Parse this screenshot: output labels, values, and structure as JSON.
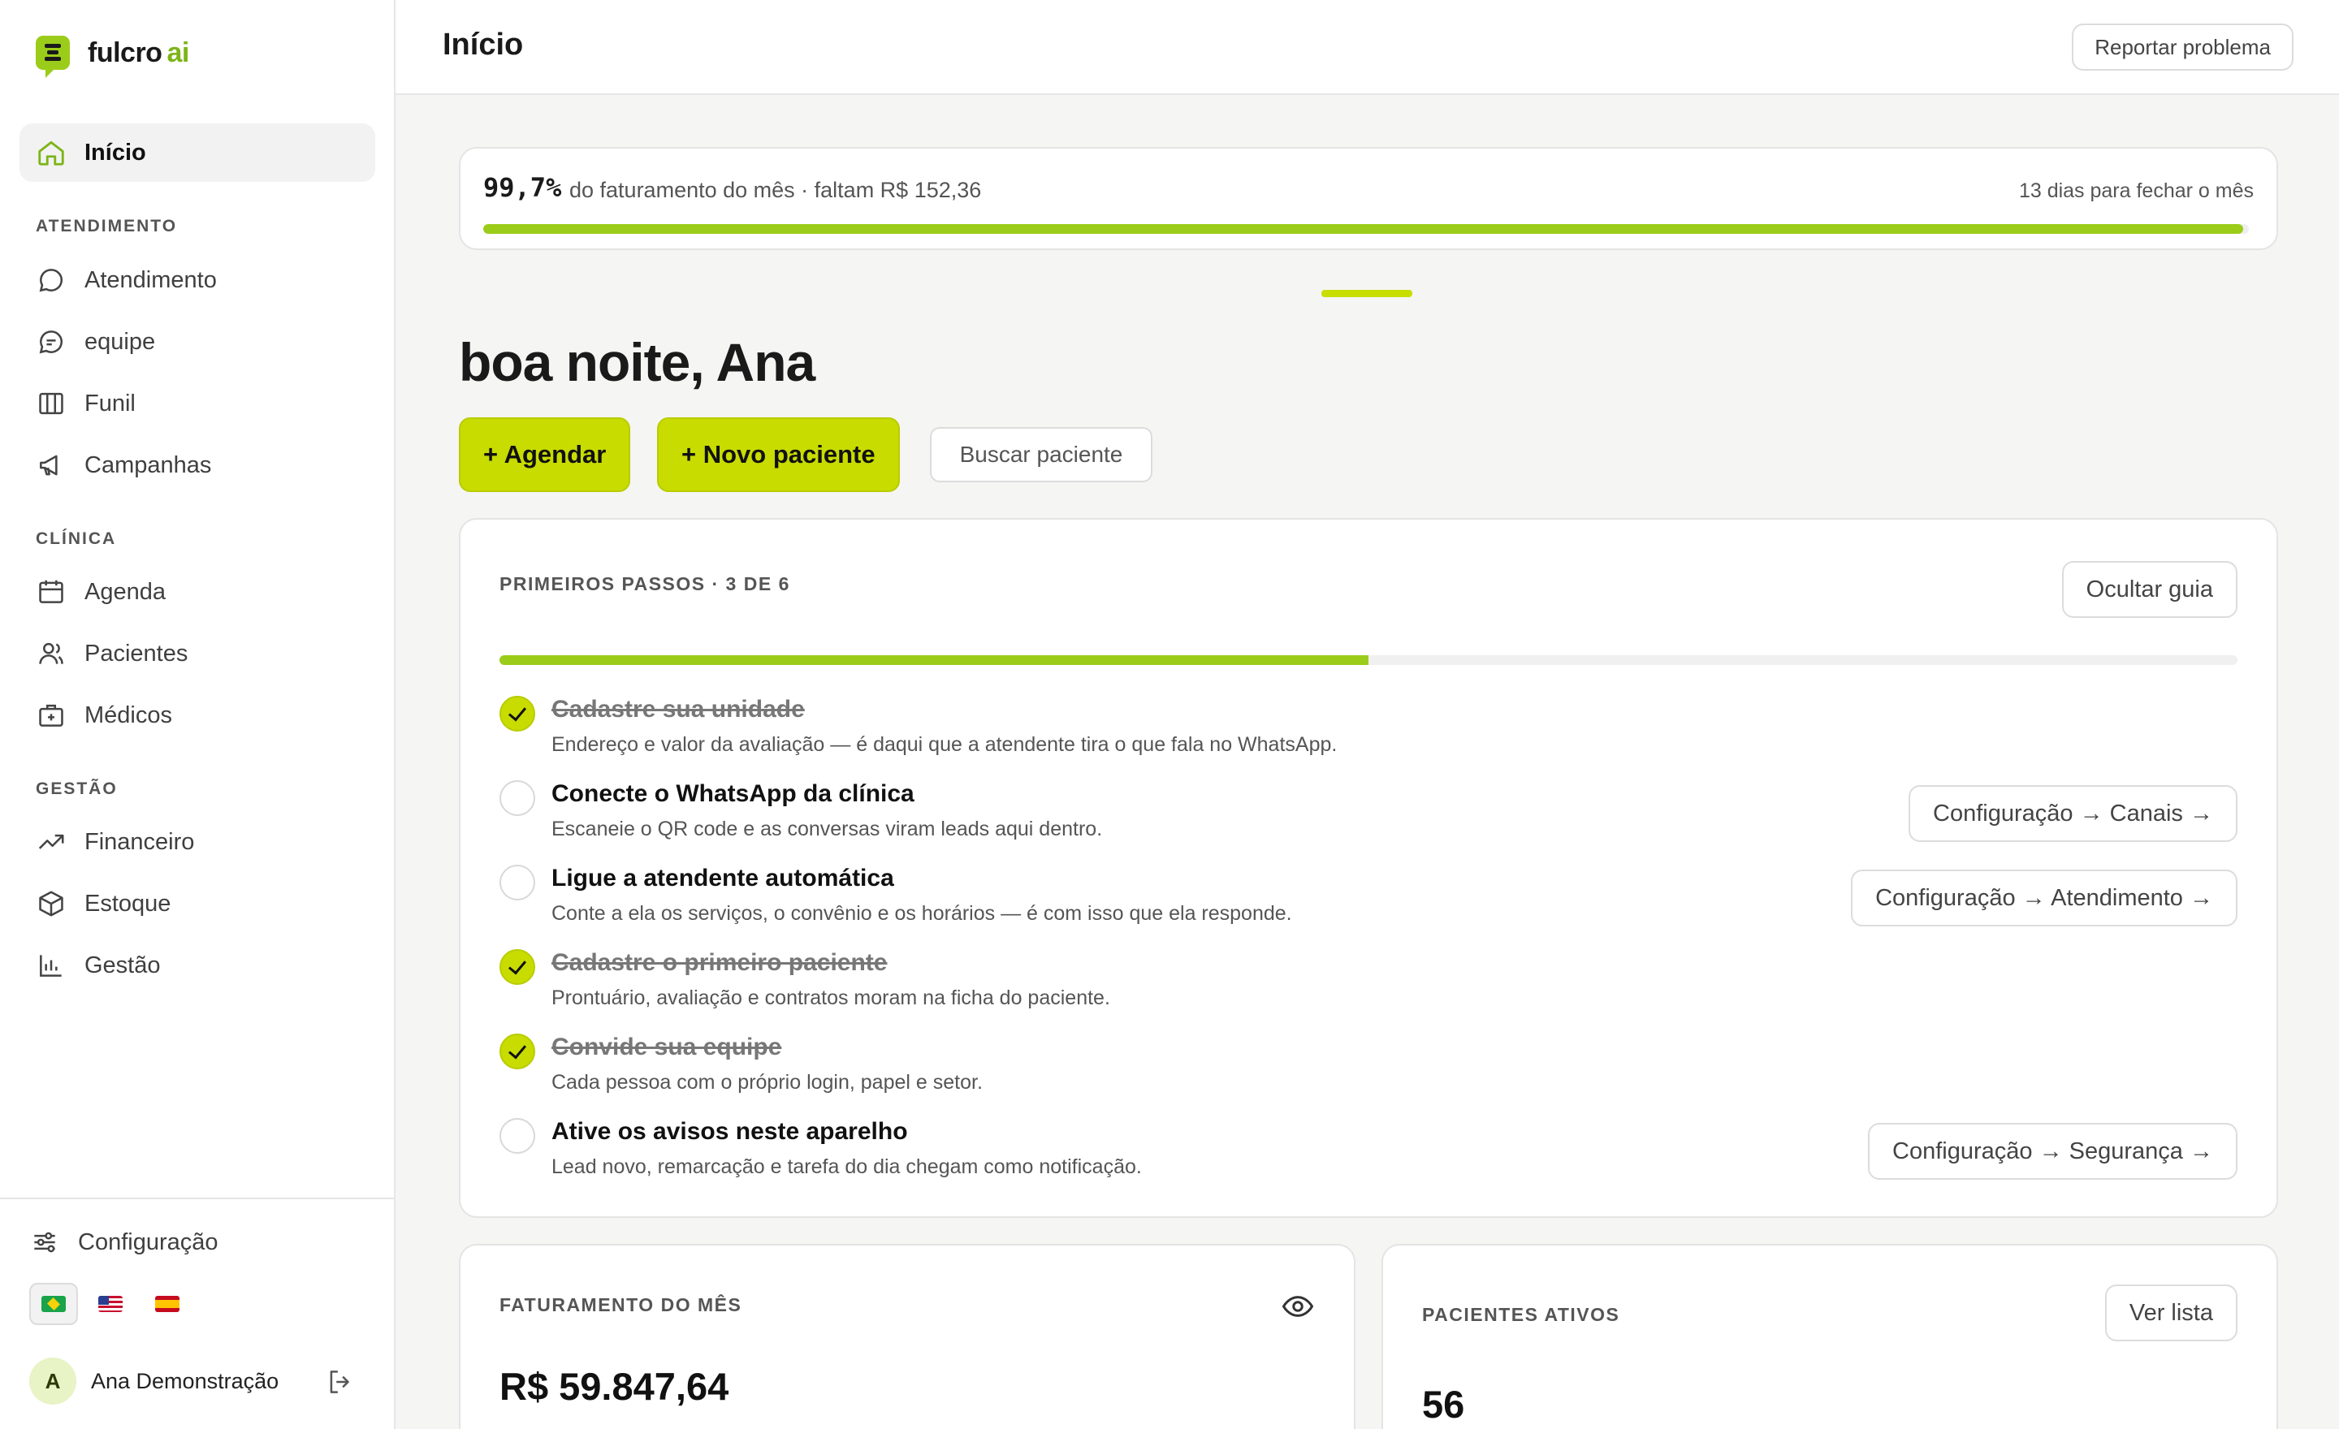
{
  "brand": {
    "name": "fulcro",
    "suffix": "ai",
    "accent": "#9ccc1a",
    "primary": "#c8dc00"
  },
  "sidebar": {
    "home": {
      "label": "Início",
      "icon": "home-icon"
    },
    "sections": [
      {
        "title": "ATENDIMENTO",
        "items": [
          {
            "label": "Atendimento",
            "icon": "chat-bubble-icon"
          },
          {
            "label": "equipe",
            "icon": "chat-dots-icon"
          },
          {
            "label": "Funil",
            "icon": "columns-icon"
          },
          {
            "label": "Campanhas",
            "icon": "megaphone-icon"
          }
        ]
      },
      {
        "title": "CLÍNICA",
        "items": [
          {
            "label": "Agenda",
            "icon": "calendar-icon"
          },
          {
            "label": "Pacientes",
            "icon": "users-icon"
          },
          {
            "label": "Médicos",
            "icon": "medical-case-icon"
          }
        ]
      },
      {
        "title": "GESTÃO",
        "items": [
          {
            "label": "Financeiro",
            "icon": "trending-up-icon"
          },
          {
            "label": "Estoque",
            "icon": "box-icon"
          },
          {
            "label": "Gestão",
            "icon": "bar-chart-icon"
          }
        ]
      }
    ],
    "settings": {
      "label": "Configuração",
      "icon": "sliders-icon"
    },
    "languages": [
      "pt-BR",
      "en-US",
      "es-ES"
    ],
    "user": {
      "initial": "A",
      "name": "Ana Demonstração"
    }
  },
  "header": {
    "title": "Início",
    "report_label": "Reportar problema"
  },
  "month_progress": {
    "percent_label": "99,7%",
    "percent": 99.7,
    "description": "do faturamento do mês · faltam R$ 152,36",
    "days_left": "13 dias para fechar o mês"
  },
  "greeting": "boa noite, Ana",
  "actions": {
    "schedule": "+ Agendar",
    "new_patient": "+ Novo paciente",
    "search": "Buscar paciente"
  },
  "guide": {
    "title": "PRIMEIROS PASSOS · 3 DE 6",
    "hide_label": "Ocultar guia",
    "progress": 0.5,
    "steps": [
      {
        "title": "Cadastre sua unidade",
        "desc": "Endereço e valor da avaliação — é daqui que a atendente tira o que fala no WhatsApp.",
        "done": true
      },
      {
        "title": "Conecte o WhatsApp da clínica",
        "desc": "Escaneie o QR code e as conversas viram leads aqui dentro.",
        "done": false,
        "action": "Configuração → Canais →"
      },
      {
        "title": "Ligue a atendente automática",
        "desc": "Conte a ela os serviços, o convênio e os horários — é com isso que ela responde.",
        "done": false,
        "action": "Configuração → Atendimento →"
      },
      {
        "title": "Cadastre o primeiro paciente",
        "desc": "Prontuário, avaliação e contratos moram na ficha do paciente.",
        "done": true
      },
      {
        "title": "Convide sua equipe",
        "desc": "Cada pessoa com o próprio login, papel e setor.",
        "done": true
      },
      {
        "title": "Ative os avisos neste aparelho",
        "desc": "Lead novo, remarcação e tarefa do dia chegam como notificação.",
        "done": false,
        "action": "Configuração → Segurança →"
      }
    ]
  },
  "kpis": {
    "revenue": {
      "label": "FATURAMENTO DO MÊS",
      "value": "R$ 59.847,64",
      "icon": "eye-icon"
    },
    "patients": {
      "label": "PACIENTES ATIVOS",
      "value": "56",
      "action": "Ver lista"
    }
  }
}
